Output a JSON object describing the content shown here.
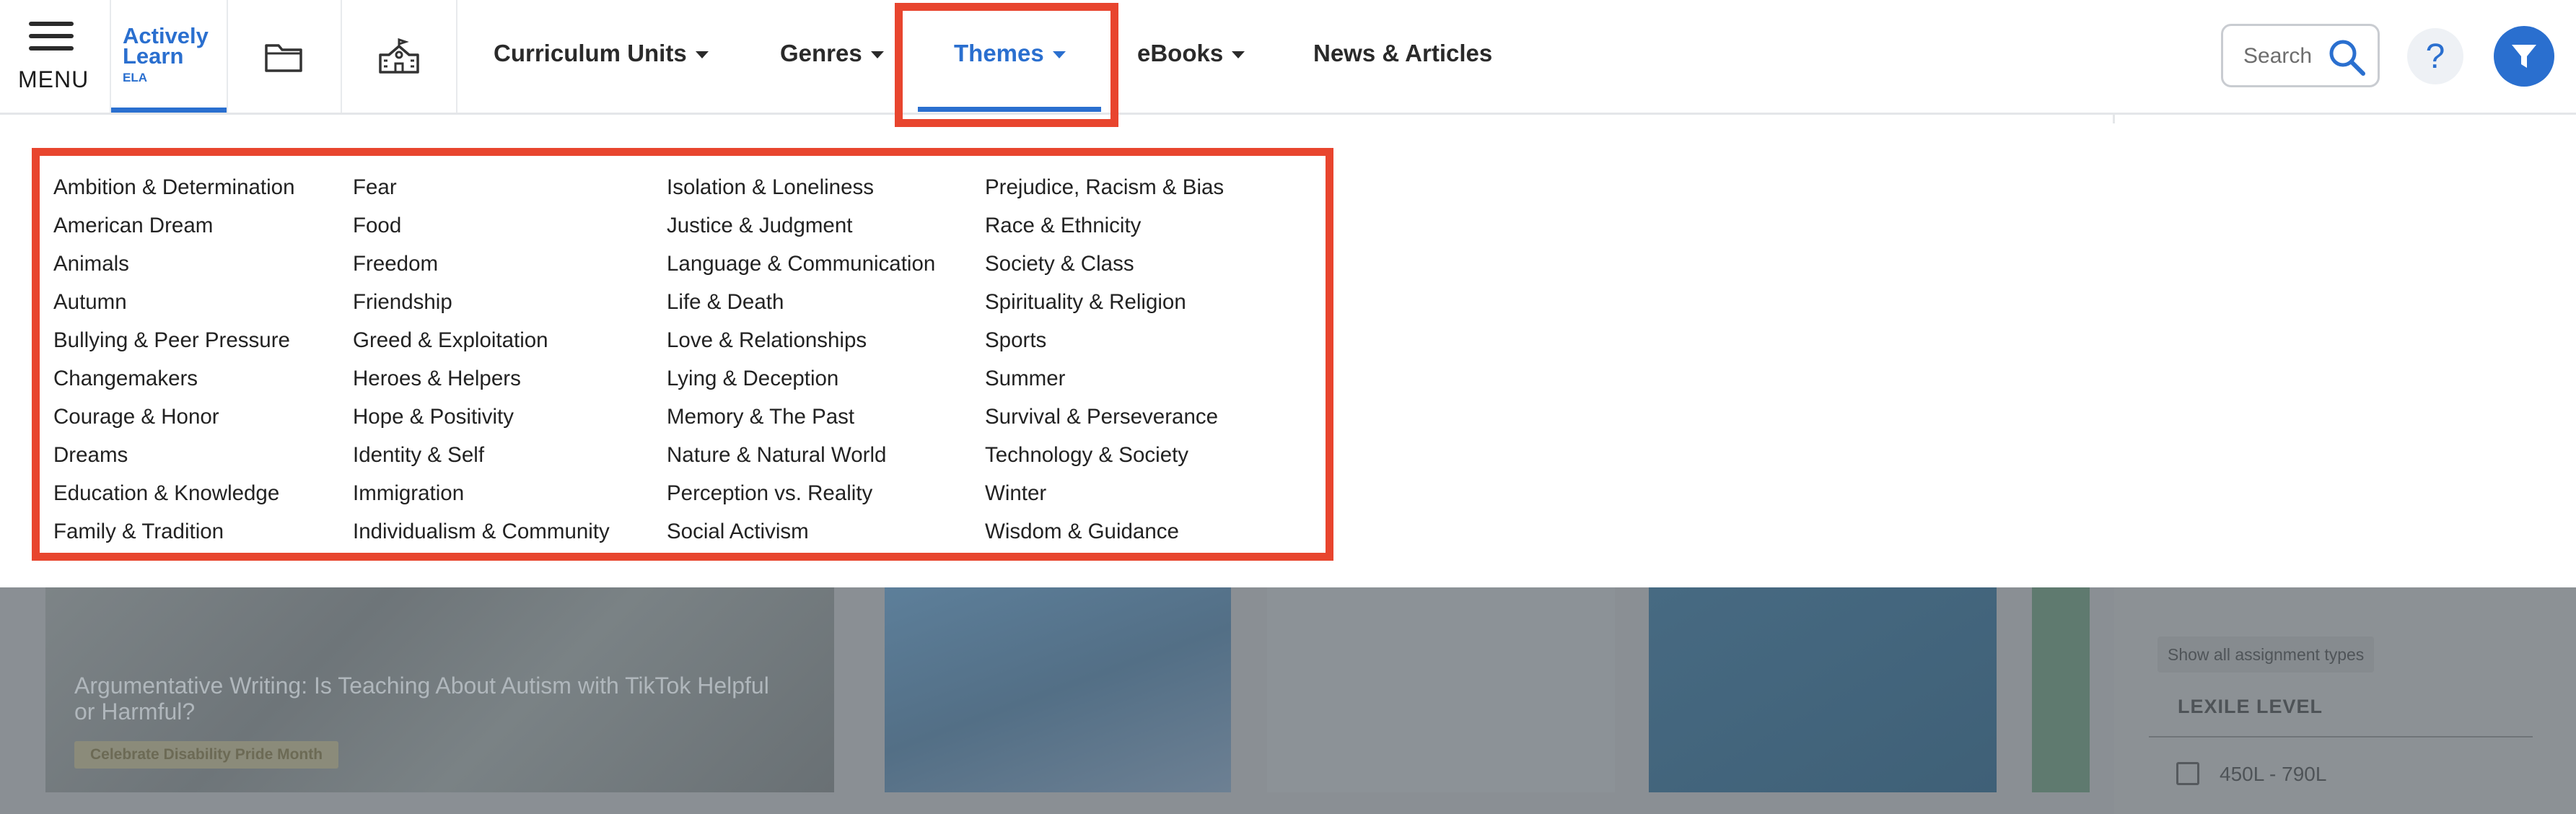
{
  "header": {
    "menu_label": "MENU",
    "logo": {
      "line1": "Actively",
      "line2": "Learn",
      "line3": "ELA"
    },
    "nav": [
      {
        "label": "Curriculum Units"
      },
      {
        "label": "Genres"
      },
      {
        "label": "Themes",
        "active": true
      },
      {
        "label": "eBooks"
      },
      {
        "label": "News & Articles"
      }
    ],
    "search_placeholder": "Search",
    "help_label": "?"
  },
  "themes": {
    "columns": [
      [
        "Ambition & Determination",
        "American Dream",
        "Animals",
        "Autumn",
        "Bullying & Peer Pressure",
        "Changemakers",
        "Courage & Honor",
        "Dreams",
        "Education & Knowledge",
        "Family & Tradition"
      ],
      [
        "Fear",
        "Food",
        "Freedom",
        "Friendship",
        "Greed & Exploitation",
        "Heroes & Helpers",
        "Hope & Positivity",
        "Identity & Self",
        "Immigration",
        "Individualism & Community"
      ],
      [
        "Isolation & Loneliness",
        "Justice & Judgment",
        "Language & Communication",
        "Life & Death",
        "Love & Relationships",
        "Lying & Deception",
        "Memory & The Past",
        "Nature & Natural World",
        "Perception vs. Reality",
        "Social Activism"
      ],
      [
        "Prejudice, Racism & Bias",
        "Race & Ethnicity",
        "Society & Class",
        "Spirituality & Religion",
        "Sports",
        "Summer",
        "Survival & Perseverance",
        "Technology & Society",
        "Winter",
        "Wisdom & Guidance"
      ]
    ]
  },
  "background": {
    "card_title": "Argumentative Writing: Is Teaching About Autism with TikTok Helpful or Harmful?",
    "card_tag": "Celebrate Disability Pride Month",
    "sidebar": {
      "show_all": "Show all assignment types",
      "section_title": "LEXILE LEVEL",
      "option": "450L - 790L"
    }
  },
  "colors": {
    "accent": "#2a6fcf",
    "highlight": "#e8452e",
    "text": "#222222"
  },
  "icons": [
    "hamburger-icon",
    "folder-icon",
    "school-icon",
    "caret-down-icon",
    "search-icon",
    "help-icon",
    "filter-icon"
  ]
}
